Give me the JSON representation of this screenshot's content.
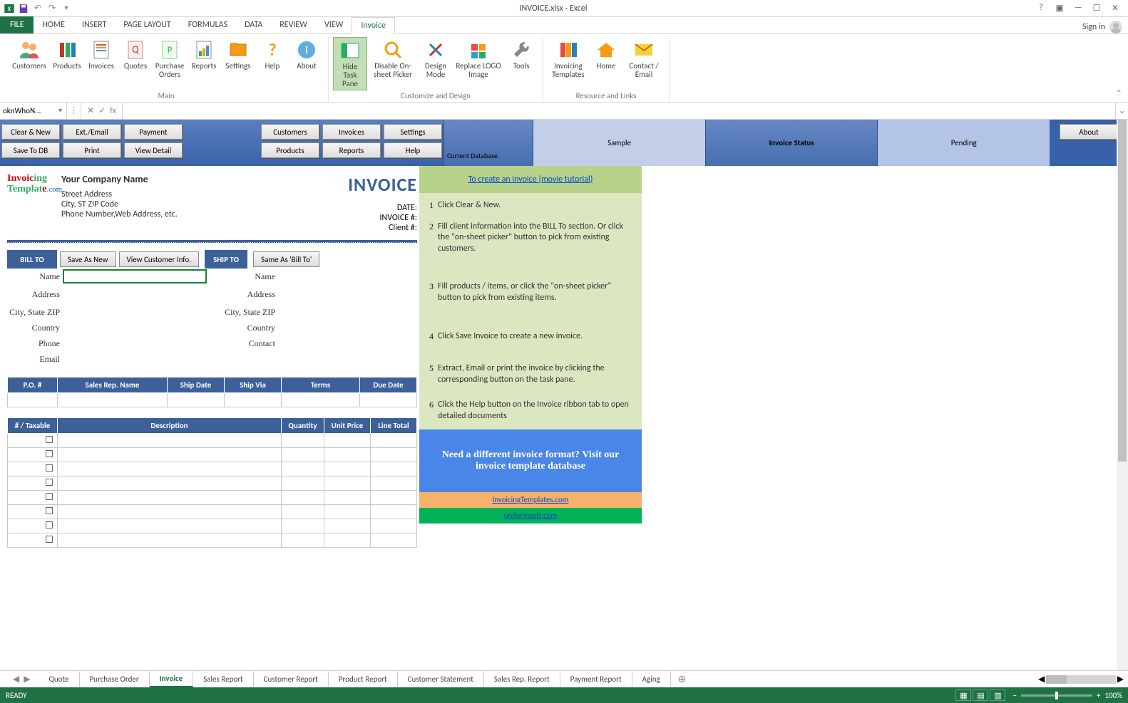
{
  "titlebar": {
    "title": "INVOICE.xlsx - Excel"
  },
  "ribbon_tabs": {
    "file": "FILE",
    "items": [
      "HOME",
      "INSERT",
      "PAGE LAYOUT",
      "FORMULAS",
      "DATA",
      "REVIEW",
      "VIEW",
      "Invoice"
    ],
    "active": "Invoice",
    "signin": "Sign in"
  },
  "ribbon": {
    "groups": {
      "main": {
        "name": "Main",
        "buttons": [
          "Customers",
          "Products",
          "Invoices",
          "Quotes",
          "Purchase Orders",
          "Reports",
          "Settings",
          "Help",
          "About"
        ]
      },
      "customize": {
        "name": "Customize and Design",
        "buttons": [
          "Hide Task Pane",
          "Disable On-sheet Picker",
          "Design Mode",
          "Replace LOGO Image",
          "Tools"
        ]
      },
      "resource": {
        "name": "Resource and Links",
        "buttons": [
          "Invoicing Templates",
          "Home",
          "Contact / Email"
        ]
      }
    },
    "active_button": "Hide Task Pane"
  },
  "formulabar": {
    "name": "oknWhoN...",
    "fx": "fx"
  },
  "cmdpanel": {
    "col1": [
      "Clear & New",
      "Save To DB"
    ],
    "col2": [
      "Ext./Email",
      "Print"
    ],
    "col3": [
      "Payment",
      "View Detail"
    ],
    "col4": [
      "Customers",
      "Products"
    ],
    "col5": [
      "Invoices",
      "Reports"
    ],
    "col6": [
      "Settings",
      "Help"
    ],
    "db_label": "Current Database",
    "db_value": "Sample",
    "status_label": "Invoice Status",
    "status_value": "Pending",
    "about": "About"
  },
  "invoice": {
    "company_name": "Your Company Name",
    "addr1": "Street Address",
    "addr2": "City, ST  ZIP Code",
    "addr3": "Phone Number,Web Address, etc.",
    "title": "INVOICE",
    "meta": [
      "DATE:",
      "INVOICE #:",
      "Client #:"
    ],
    "billto": "BILL TO",
    "shipto": "SHIP TO",
    "save_as_new": "Save As New",
    "view_cust": "View Customer Info.",
    "same_as": "Same As 'Bill To'",
    "bill_fields": [
      "Name",
      "Address",
      "City, State ZIP",
      "Country",
      "Phone",
      "Email"
    ],
    "ship_fields": [
      "Name",
      "Address",
      "City, State ZIP",
      "Country",
      "Contact"
    ],
    "po_headers": [
      "P.O. #",
      "Sales Rep. Name",
      "Ship Date",
      "Ship Via",
      "Terms",
      "Due Date"
    ],
    "item_headers": [
      "# / Taxable",
      "Description",
      "Quantity",
      "Unit Price",
      "Line Total"
    ]
  },
  "help": {
    "tutorial": "To create an invoice (movie tutorial)",
    "steps": [
      "Click Clear & New.",
      "Fill client information into the BILL To section. Or click the \"on-sheet picker\" button to pick from existing customers.",
      "Fill products / items, or click the \"on-sheet picker\" button to pick from existing items.",
      "Click Save Invoice to create a new invoice.",
      "Extract, Email or print the invoice by clicking the corresponding button on the task pane.",
      "Click the Help button on the Invoice ribbon tab to open detailed documents"
    ],
    "promo": "Need a different invoice format? Visit our invoice template database",
    "link1": "InvoicingTemplates.com",
    "link2": "uniformsoft.com"
  },
  "sheets": [
    "Quote",
    "Purchase Order",
    "Invoice",
    "Sales Report",
    "Customer Report",
    "Product Report",
    "Customer Statement",
    "Sales Rep. Report",
    "Payment Report",
    "Aging"
  ],
  "active_sheet": "Invoice",
  "statusbar": {
    "ready": "READY",
    "zoom": "100%"
  }
}
